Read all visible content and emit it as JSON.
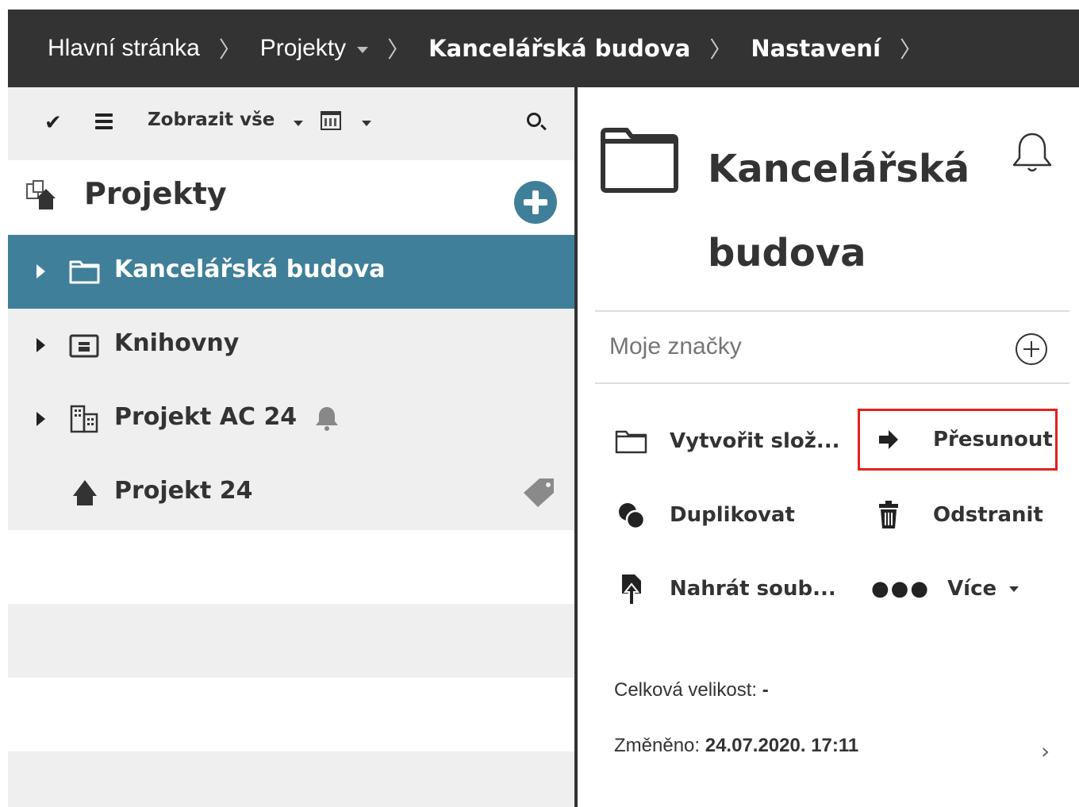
{
  "breadcrumb": {
    "items": [
      {
        "label": "Hlavní stránka"
      },
      {
        "label": "Projekty"
      },
      {
        "label": "Kancelářská budova"
      },
      {
        "label": "Nastavení"
      }
    ]
  },
  "sidebar": {
    "toolbar": {
      "filter_label": "Zobrazit vše"
    },
    "title": "Projekty",
    "items": [
      {
        "label": "Kancelářská budova",
        "selected": true
      },
      {
        "label": "Knihovny"
      },
      {
        "label": "Projekt AC 24"
      },
      {
        "label": "Projekt 24"
      }
    ]
  },
  "detail": {
    "title": "Kancelářská budova",
    "tags_placeholder": "Moje značky",
    "actions": {
      "create_folder": "Vytvořit slož...",
      "move": "Přesunout",
      "duplicate": "Duplikovat",
      "delete": "Odstranit",
      "upload": "Nahrát soub...",
      "more": "Více"
    },
    "size_label": "Celková velikost:",
    "size_value": "-",
    "modified_label": "Změněno:",
    "modified_value": "24.07.2020. 17:11"
  },
  "colors": {
    "topbar": "#333333",
    "accent": "#3f7f99",
    "highlight": "#e3211c"
  }
}
